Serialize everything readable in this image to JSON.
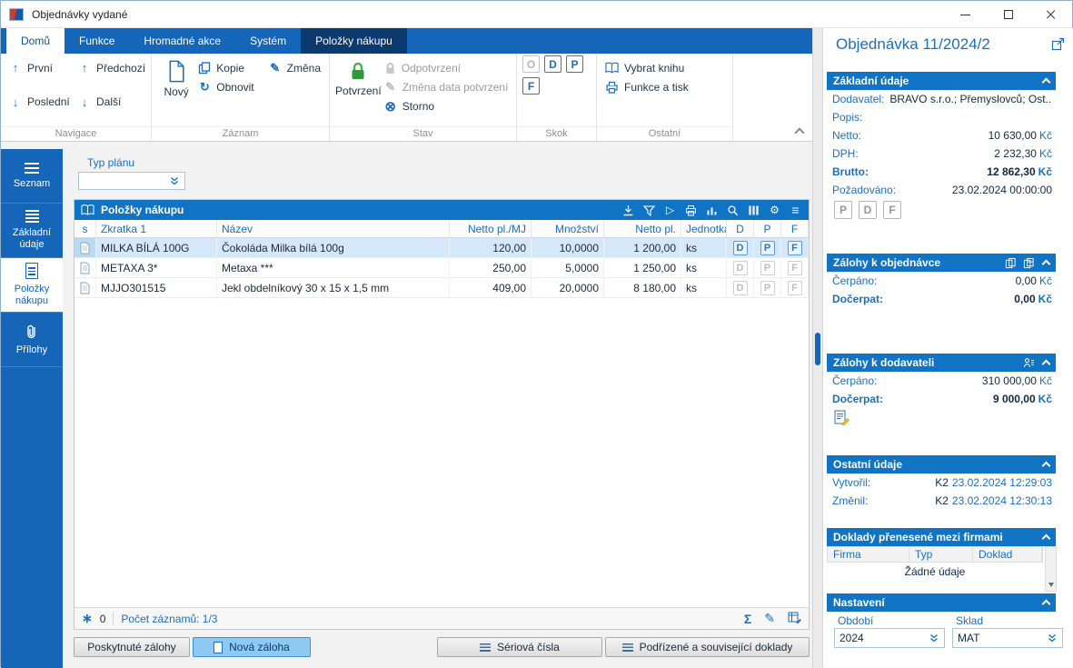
{
  "icons": {
    "up_arrow": "↑",
    "down_arrow": "↓",
    "pencil": "✎",
    "refresh": "↻",
    "storno": "⊗",
    "run": "▷",
    "menu": "≡",
    "gear": "⚙",
    "sum": "Σ",
    "asterisk": "∗"
  },
  "window": {
    "title": "Objednávky vydané"
  },
  "tabs": [
    {
      "label": "Domů"
    },
    {
      "label": "Funkce"
    },
    {
      "label": "Hromadné akce"
    },
    {
      "label": "Systém"
    },
    {
      "label": "Položky nákupu"
    }
  ],
  "ribbon": {
    "navigace": {
      "label": "Navigace",
      "prvni": "První",
      "posledni": "Poslední",
      "predchozi": "Předchozí",
      "dalsi": "Další"
    },
    "zaznam": {
      "label": "Záznam",
      "novy": "Nový",
      "kopie": "Kopie",
      "zmena": "Změna",
      "obnovit": "Obnovit"
    },
    "stav": {
      "label": "Stav",
      "potvrzeni": "Potvrzení",
      "odpotvrzeni": "Odpotvrzení",
      "zmena_data": "Změna data potvrzení",
      "storno": "Storno"
    },
    "skok": {
      "label": "Skok",
      "o": "O",
      "d": "D",
      "p": "P",
      "f": "F"
    },
    "ostatni": {
      "label": "Ostatní",
      "vybrat_knihu": "Vybrat knihu",
      "funkce_tisk": "Funkce a tisk"
    }
  },
  "sidebar": {
    "items": [
      {
        "label": "Seznam"
      },
      {
        "label": "Základní údaje"
      },
      {
        "label": "Položky nákupu"
      },
      {
        "label": "Přílohy"
      }
    ]
  },
  "main": {
    "typ_planu": {
      "label": "Typ plánu",
      "value": ""
    },
    "grid": {
      "title": "Položky nákupu",
      "columns": {
        "s": "s",
        "zkratka": "Zkratka 1",
        "nazev": "Název",
        "netto_mj": "Netto pl./MJ",
        "mnozstvi": "Množství",
        "netto": "Netto pl.",
        "jednotka": "Jednotka",
        "d": "D",
        "p": "P",
        "f": "F"
      },
      "rows": [
        {
          "zkratka": "MILKA BÍLÁ 100G",
          "nazev": "Čokoláda Milka bílá 100g",
          "netto_mj": "120,00",
          "mnozstvi": "10,0000",
          "netto": "1 200,00",
          "jednotka": "ks",
          "d": "D",
          "p": "P",
          "f": "F"
        },
        {
          "zkratka": "METAXA 3*",
          "nazev": "Metaxa ***",
          "netto_mj": "250,00",
          "mnozstvi": "5,0000",
          "netto": "1 250,00",
          "jednotka": "ks",
          "d": "D",
          "p": "P",
          "f": "F"
        },
        {
          "zkratka": "MJJO301515",
          "nazev": "Jekl obdelníkový 30 x 15 x 1,5 mm",
          "netto_mj": "409,00",
          "mnozstvi": "20,0000",
          "netto": "8 180,00",
          "jednotka": "ks",
          "d": "D",
          "p": "P",
          "f": "F"
        }
      ]
    },
    "status": {
      "badge": "0",
      "records": "Počet záznamů: 1/3"
    },
    "buttons": {
      "poskytnute": "Poskytnuté zálohy",
      "nova_zaloha": "Nová záloha",
      "seriova": "Sériová čísla",
      "podrizene": "Podřízené a související doklady"
    }
  },
  "panel": {
    "title": "Objednávka 11/2024/2",
    "zakladni": {
      "title": "Základní údaje",
      "rows": [
        {
          "label": "Dodavatel:",
          "value": "BRAVO s.r.o.; Přemyslovců; Ost..."
        },
        {
          "label": "Popis:",
          "value": ""
        },
        {
          "label": "Netto:",
          "value": "10 630,00",
          "currency": "Kč"
        },
        {
          "label": "DPH:",
          "value": "2 232,30",
          "currency": "Kč"
        },
        {
          "label": "Brutto:",
          "value": "12 862,30",
          "currency": "Kč"
        },
        {
          "label": "Požadováno:",
          "value": "23.02.2024 00:00:00"
        }
      ],
      "flags": [
        "P",
        "D",
        "F"
      ]
    },
    "zalohy_obj": {
      "title": "Zálohy k objednávce",
      "rows": [
        {
          "label": "Čerpáno:",
          "value": "0,00",
          "currency": "Kč"
        },
        {
          "label": "Dočerpat:",
          "value": "0,00",
          "currency": "Kč"
        }
      ]
    },
    "zalohy_dod": {
      "title": "Zálohy k dodavateli",
      "rows": [
        {
          "label": "Čerpáno:",
          "value": "310 000,00",
          "currency": "Kč"
        },
        {
          "label": "Dočerpat:",
          "value": "9 000,00",
          "currency": "Kč"
        }
      ]
    },
    "ostatni": {
      "title": "Ostatní údaje",
      "rows": [
        {
          "label": "Vytvořil:",
          "user": "K2",
          "value": "23.02.2024 12:29:03"
        },
        {
          "label": "Změnil:",
          "user": "K2",
          "value": "23.02.2024 12:30:13"
        }
      ]
    },
    "doklady": {
      "title": "Doklady přenesené mezi firmami",
      "columns": [
        "Firma",
        "Typ",
        "Doklad"
      ],
      "empty": "Žádné údaje"
    },
    "nastaveni": {
      "title": "Nastavení",
      "obdobi_label": "Období",
      "obdobi_value": "2024",
      "sklad_label": "Sklad",
      "sklad_value": "MAT"
    }
  }
}
